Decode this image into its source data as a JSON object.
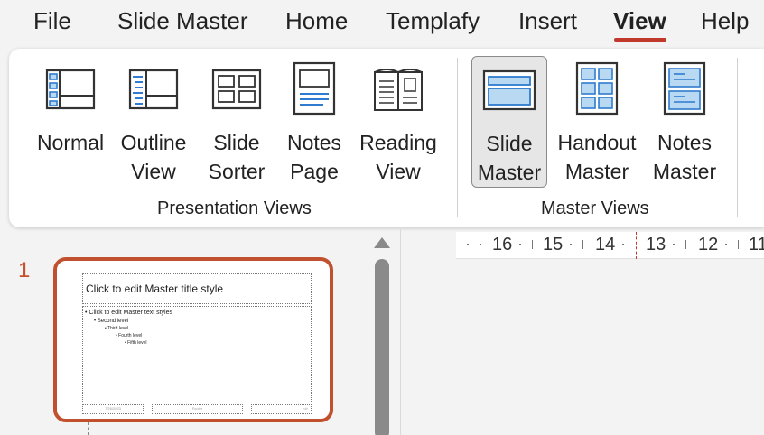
{
  "menu": {
    "items": [
      "File",
      "Slide Master",
      "Home",
      "Templafy",
      "Insert",
      "View",
      "Help"
    ],
    "active": "View",
    "accent_color": "#c0392b"
  },
  "ribbon": {
    "presentation_views": {
      "group_label": "Presentation Views",
      "buttons": [
        {
          "line1": "Normal",
          "line2": "",
          "icon": "normal-view-icon"
        },
        {
          "line1": "Outline",
          "line2": "View",
          "icon": "outline-view-icon"
        },
        {
          "line1": "Slide",
          "line2": "Sorter",
          "icon": "slide-sorter-icon"
        },
        {
          "line1": "Notes",
          "line2": "Page",
          "icon": "notes-page-icon"
        },
        {
          "line1": "Reading",
          "line2": "View",
          "icon": "reading-view-icon"
        }
      ]
    },
    "master_views": {
      "group_label": "Master Views",
      "buttons": [
        {
          "line1": "Slide",
          "line2": "Master",
          "icon": "slide-master-icon",
          "selected": true
        },
        {
          "line1": "Handout",
          "line2": "Master",
          "icon": "handout-master-icon"
        },
        {
          "line1": "Notes",
          "line2": "Master",
          "icon": "notes-master-icon"
        }
      ]
    },
    "icon_blue": "#2e7bcf",
    "icon_fill": "#b9d9f2"
  },
  "thumbnails": {
    "slide_number": "1",
    "title_placeholder": "Click to edit Master title style",
    "body_levels": [
      "Click to edit Master text styles",
      "Second level",
      "Third level",
      "Fourth level",
      "Fifth level"
    ],
    "footer_date": "7/26/2023",
    "footer_text": "Footer",
    "footer_page": "‹#›",
    "selection_color": "#c0502e"
  },
  "ruler": {
    "numbers": [
      "16",
      "15",
      "14",
      "13",
      "12",
      "11"
    ]
  }
}
